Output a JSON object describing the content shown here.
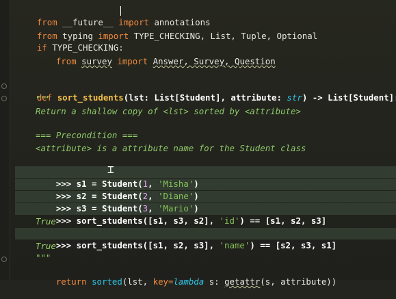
{
  "code": {
    "l1": {
      "kw1": "from",
      "mod": "__future__",
      "kw2": "import",
      "name": "annotations"
    },
    "l2": {
      "kw1": "from",
      "mod": "typing",
      "kw2": "import",
      "names": "TYPE_CHECKING, List, Tuple, Optional"
    },
    "l3": {
      "kw": "if",
      "cond": "TYPE_CHECKING:"
    },
    "l4": {
      "kw1": "from",
      "mod": "survey",
      "kw2": "import",
      "names": "Answer, Survey, Question"
    },
    "l5": {
      "kw": "def",
      "fn": "sort_students",
      "p1": "(lst: ",
      "t1": "List[Student]",
      "sep": ", ",
      "attr": "attribute",
      "colon": ": ",
      "type": "str",
      "arrow": ") -> ",
      "ret": "List[Student]:"
    },
    "doc_open": "\"\"\"",
    "doc1": "Return a shallow copy of <lst> sorted by <attribute>",
    "doc2": "=== Precondition ===",
    "doc3": "<attribute> is a attribute name for the Student class",
    "ex1": {
      "pre": ">>> s1 = ",
      "cls": "Student",
      "a": "(",
      "n": "1",
      "b": ", ",
      "s": "'Misha'",
      "c": ")"
    },
    "ex2": {
      "pre": ">>> s2 = ",
      "cls": "Student",
      "a": "(",
      "n": "2",
      "b": ", ",
      "s": "'Diane'",
      "c": ")"
    },
    "ex3": {
      "pre": ">>> s3 = ",
      "cls": "Student",
      "a": "(",
      "n": "3",
      "b": ", ",
      "s": "'Mario'",
      "c": ")"
    },
    "ex4": {
      "pre": ">>> sort_students([s1, s3, s2], ",
      "s": "'id'",
      "post": ") == [s1, s2, s3]"
    },
    "res1": "True",
    "ex5": {
      "pre": ">>> sort_students([s1, s2, s3], ",
      "s": "'name'",
      "post": ") == [s2, s3, s1]"
    },
    "res2": "True",
    "doc_close": "\"\"\"",
    "ret": {
      "kw": "return",
      "fn": "sorted",
      "p1": "(lst, ",
      "kwarg": "key",
      "eq": "=",
      "lam": "lambda",
      "arg": " s: ",
      "call": "getattr",
      "rest": "(s, attribute))"
    }
  }
}
